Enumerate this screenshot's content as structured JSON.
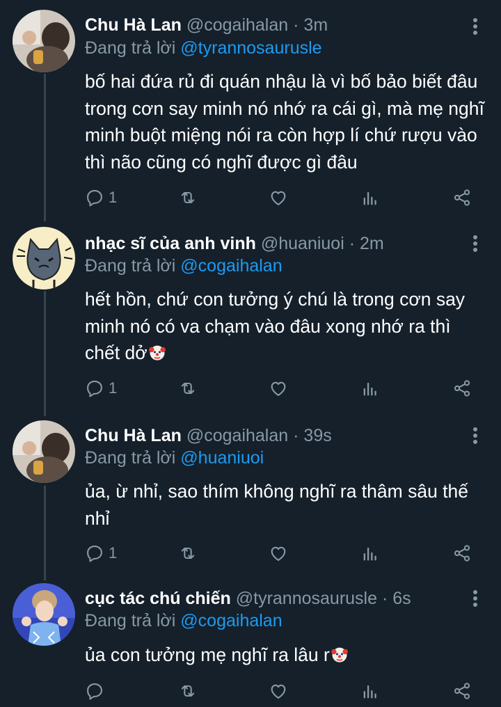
{
  "replying_label": "Đang trả lời",
  "tweets": [
    {
      "name": "Chu Hà Lan",
      "handle": "@cogaihalan",
      "time": "· 3m",
      "reply_to": "@tyrannosaurusle",
      "text": "bố hai đứa rủ đi quán nhậu là vì bố bảo biết đâu\ntrong cơn say minh nó nhớ ra cái gì, mà mẹ nghĩ\nminh buột miệng nói ra còn hợp lí chứ rượu vào\nthì não cũng có nghĩ được gì đâu",
      "reply_count": "1"
    },
    {
      "name": "nhạc sĩ của anh vinh",
      "handle": "@huaniuoi",
      "time": "· 2m",
      "reply_to": "@cogaihalan",
      "text": "hết hồn, chứ con tưởng ý chú là trong cơn say\nminh nó có va chạm vào đâu xong nhớ ra thì\nchết dở",
      "reply_count": "1"
    },
    {
      "name": "Chu Hà Lan",
      "handle": "@cogaihalan",
      "time": "· 39s",
      "reply_to": "@huaniuoi",
      "text": "ủa, ừ nhỉ, sao thím không nghĩ ra thâm sâu thế\nnhỉ",
      "reply_count": "1"
    },
    {
      "name": "cục tác chú chiến",
      "handle": "@tyrannosaurusle",
      "time": "· 6s",
      "reply_to": "@cogaihalan",
      "text": "ủa con tưởng mẹ nghĩ ra lâu r",
      "reply_count": ""
    }
  ],
  "icons": [
    "reply-icon",
    "retweet-icon",
    "like-icon",
    "analytics-icon",
    "share-icon",
    "more-icon",
    "clown-emoji"
  ],
  "colors": {
    "background": "#15202b",
    "secondary_text": "#8899a6",
    "link": "#1d9bf0",
    "thread_line": "#38444d"
  }
}
